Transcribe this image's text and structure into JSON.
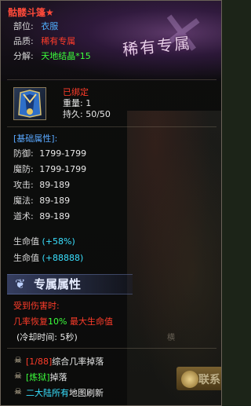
{
  "item": {
    "name": "骷髅斗篷★",
    "type_label": "部位:",
    "type_value": "衣服",
    "quality_label": "品质:",
    "quality_value": "稀有专属",
    "decompose_label": "分解:",
    "decompose_value": "天地结晶*15",
    "rarity_stamp": "稀有专属",
    "bound": "已绑定",
    "weight": "重量: 1",
    "durability": "持久: 50/50",
    "icon": "cloak-icon"
  },
  "basic": {
    "header": "[基础属性]:",
    "stats": [
      {
        "label": "防御:",
        "value": "1799-1799"
      },
      {
        "label": "魔防:",
        "value": "1799-1799"
      },
      {
        "label": "攻击:",
        "value": "89-189"
      },
      {
        "label": "魔法:",
        "value": "89-189"
      },
      {
        "label": "道术:",
        "value": "89-189"
      }
    ]
  },
  "life": [
    {
      "label": "生命值",
      "value": "(+58%)"
    },
    {
      "label": "生命值",
      "value": "(+88888)"
    }
  ],
  "exclusive": {
    "title": "专属属性",
    "icon": "wing-icon",
    "trigger": "受到伤害时:",
    "effect_prefix": "几率恢复",
    "effect_percent": "10%",
    "effect_suffix": "最大生命值",
    "cooldown": "(冷却时间: 5秒)"
  },
  "drops": [
    {
      "icon": "skull-icon",
      "bracket": "[1/88]",
      "text": "综合几率掉落"
    },
    {
      "icon": "skull-icon",
      "bracket": "[炼狱]",
      "text": "掉落"
    },
    {
      "icon": "skull-icon",
      "highlight": "二大陆所有",
      "text": "地图刷新"
    }
  ],
  "background": {
    "button_label": "联系",
    "vertical_label": "横"
  },
  "colors": {
    "name": "#ff4a3a",
    "blue": "#4fb0ff",
    "red": "#ff3c2a",
    "green": "#3cff3c",
    "cyan": "#39e0ff"
  }
}
